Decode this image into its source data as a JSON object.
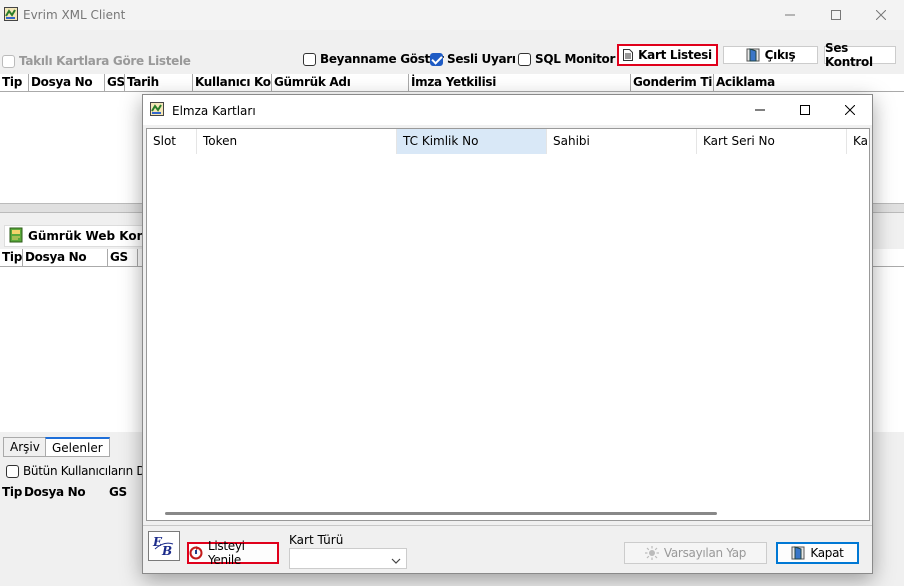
{
  "main": {
    "title": "Evrim XML Client",
    "toolbar": {
      "takili_label": "Takılı Kartlara Göre Listele",
      "beyanname_label": "Beyanname Göster",
      "sesli_label": "Sesli Uyarı",
      "sql_label": "SQL Monitor",
      "kart_listesi_label": "Kart Listesi",
      "cikis_label": "Çıkış",
      "ses_kontrol_label": "Ses Kontrol"
    },
    "grid1_columns": [
      "Tip",
      "Dosya No",
      "GS",
      "Tarih",
      "Kullanıcı Kodu",
      "Gümrük Adı",
      "İmza Yetkilisi",
      "Gonderim Tipi",
      "Aciklama"
    ],
    "web_title": "Gümrük Web Kontrol",
    "grid2_columns": [
      "Tip",
      "Dosya No",
      "GS",
      ""
    ],
    "tabs": [
      "Arşiv",
      "Gelenler"
    ],
    "butun_label": "Bütün Kullanıcıların Dosyaları",
    "grid3_columns": [
      "Tip",
      "Dosya No",
      "GS"
    ]
  },
  "modal": {
    "title": "Elmza Kartları",
    "columns": [
      "Slot",
      "Token",
      "TC Kimlik No",
      "Sahibi",
      "Kart Seri No",
      "Kar"
    ],
    "listeyi_yenile": "Listeyi Yenile",
    "kart_turu_label": "Kart Türü",
    "kart_turu_value": "",
    "varsayilan_label": "Varsayılan Yap",
    "kapat_label": "Kapat"
  },
  "colors": {
    "highlight_red": "#e0001b",
    "accent_blue": "#1e5bc4",
    "selected_header": "#d9e8f7"
  }
}
